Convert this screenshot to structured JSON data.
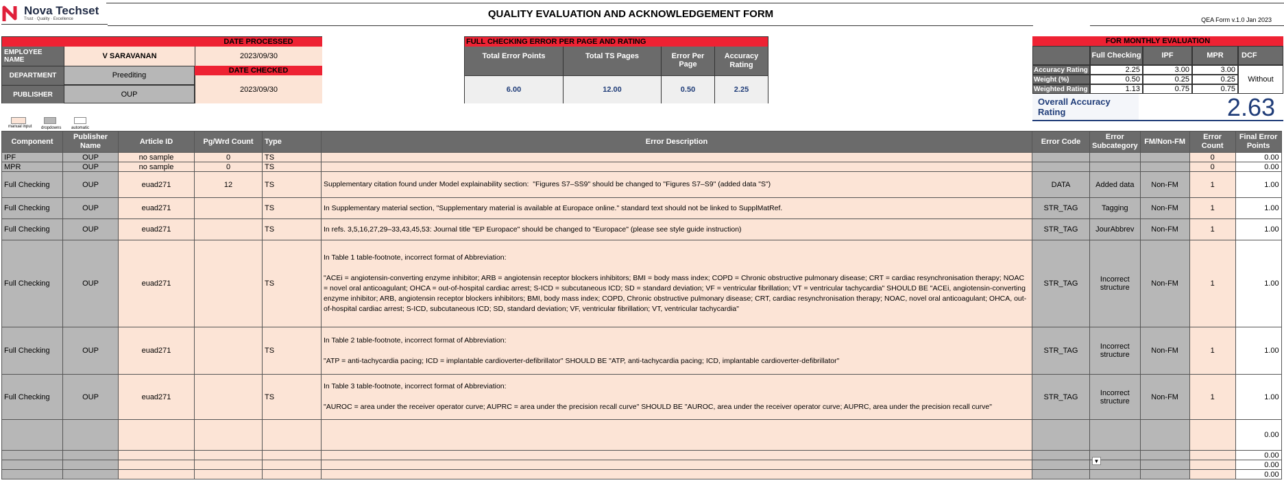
{
  "brand": {
    "name": "Nova Techset",
    "tagline": "Trust · Quality · Excellence"
  },
  "form_title": "QUALITY EVALUATION AND ACKNOWLEDGEMENT FORM",
  "form_version": "QEA Form v.1.0 Jan 2023",
  "employee": {
    "name_label": "EMPLOYEE NAME",
    "name": "V SARAVANAN",
    "dept_label": "DEPARTMENT",
    "dept": "Preediting",
    "pub_label": "PUBLISHER",
    "pub": "OUP",
    "date_processed_label": "DATE PROCESSED",
    "date_processed": "2023/09/30",
    "date_checked_label": "DATE CHECKED",
    "date_checked": "2023/09/30"
  },
  "full_check": {
    "header": "FULL CHECKING ERROR PER PAGE AND RATING",
    "cols": [
      "Total Error Points",
      "Total TS Pages",
      "Error Per Page",
      "Accuracy Rating"
    ],
    "vals": [
      "6.00",
      "12.00",
      "0.50",
      "2.25"
    ]
  },
  "monthly": {
    "header": "FOR MONTHLY EVALUATION",
    "cols": [
      "Full Checking",
      "IPF",
      "MPR",
      "DCF"
    ],
    "rows": [
      {
        "label": "Accuracy Rating",
        "vals": [
          "2.25",
          "3.00",
          "3.00"
        ]
      },
      {
        "label": "Weight (%)",
        "vals": [
          "0.50",
          "0.25",
          "0.25"
        ]
      },
      {
        "label": "Weighted Rating",
        "vals": [
          "1.13",
          "0.75",
          "0.75"
        ]
      }
    ],
    "dcf": "Without",
    "overall_label": "Overall Accuracy Rating",
    "overall_value": "2.63"
  },
  "legend": [
    "manual input",
    "dropdowns",
    "automatic"
  ],
  "table": {
    "headers": [
      "Component",
      "Publisher Name",
      "Article ID",
      "Pg/Wrd Count",
      "Type",
      "Error Description",
      "Error Code",
      "Error Subcategory",
      "FM/Non-FM",
      "Error Count",
      "Final Error Points"
    ],
    "rows": [
      {
        "comp": "IPF",
        "pub": "OUP",
        "art": "no sample",
        "pg": "0",
        "type": "TS",
        "desc": "",
        "code": "",
        "sub": "",
        "fm": "",
        "cnt": "0",
        "pts": "0.00"
      },
      {
        "comp": "MPR",
        "pub": "OUP",
        "art": "no sample",
        "pg": "0",
        "type": "TS",
        "desc": "",
        "code": "",
        "sub": "",
        "fm": "",
        "cnt": "0",
        "pts": "0.00"
      },
      {
        "comp": "Full Checking",
        "pub": "OUP",
        "art": "euad271",
        "pg": "12",
        "type": "TS",
        "desc": "Supplementary citation found under Model explainability section:  \"Figures S7–SS9\" should be changed to \"Figures S7–S9\" (added data \"S\")",
        "code": "DATA",
        "sub": "Added data",
        "fm": "Non-FM",
        "cnt": "1",
        "pts": "1.00"
      },
      {
        "comp": "Full Checking",
        "pub": "OUP",
        "art": "euad271",
        "pg": "",
        "type": "TS",
        "desc": "In Supplementary material section, \"Supplementary material is available at Europace online.\" standard text should not be linked to SupplMatRef.",
        "code": "STR_TAG",
        "sub": "Tagging",
        "fm": "Non-FM",
        "cnt": "1",
        "pts": "1.00"
      },
      {
        "comp": "Full Checking",
        "pub": "OUP",
        "art": "euad271",
        "pg": "",
        "type": "TS",
        "desc": "In refs. 3,5,16,27,29–33,43,45,53: Journal title \"EP Europace\" should be changed to \"Europace\" (please see style guide instruction)",
        "code": "STR_TAG",
        "sub": "JourAbbrev",
        "fm": "Non-FM",
        "cnt": "1",
        "pts": "1.00"
      },
      {
        "comp": "Full Checking",
        "pub": "OUP",
        "art": "euad271",
        "pg": "",
        "type": "TS",
        "desc": "In Table 1 table-footnote, incorrect format of Abbreviation:\n\n\"ACEi = angiotensin-converting enzyme inhibitor; ARB = angiotensin receptor blockers inhibitors; BMI = body mass index; COPD = Chronic obstructive pulmonary disease; CRT = cardiac resynchronisation therapy; NOAC = novel oral anticoagulant; OHCA = out-of-hospital cardiac arrest; S-ICD = subcutaneous ICD; SD = standard deviation; VF = ventricular fibrillation; VT = ventricular tachycardia\" SHOULD BE \"ACEi, angiotensin-converting enzyme inhibitor; ARB, angiotensin receptor blockers inhibitors; BMI, body mass index; COPD, Chronic obstructive pulmonary disease; CRT, cardiac resynchronisation therapy; NOAC, novel oral anticoagulant; OHCA, out-of-hospital cardiac arrest; S-ICD, subcutaneous ICD; SD, standard deviation; VF, ventricular fibrillation; VT, ventricular tachycardia\"",
        "code": "STR_TAG",
        "sub": "Incorrect structure",
        "fm": "Non-FM",
        "cnt": "1",
        "pts": "1.00"
      },
      {
        "comp": "Full Checking",
        "pub": "OUP",
        "art": "euad271",
        "pg": "",
        "type": "TS",
        "desc": "In Table 2 table-footnote, incorrect format of Abbreviation:\n\n\"ATP = anti-tachycardia pacing; ICD = implantable cardioverter-defibrillator\" SHOULD BE \"ATP, anti-tachycardia pacing; ICD, implantable cardioverter-defibrillator\"",
        "code": "STR_TAG",
        "sub": "Incorrect structure",
        "fm": "Non-FM",
        "cnt": "1",
        "pts": "1.00"
      },
      {
        "comp": "Full Checking",
        "pub": "OUP",
        "art": "euad271",
        "pg": "",
        "type": "TS",
        "desc": "In Table 3 table-footnote, incorrect format of Abbreviation:\n\n\"AUROC = area under the receiver operator curve; AUPRC = area under the precision recall curve\" SHOULD BE \"AUROC, area under the receiver operator curve; AUPRC, area under the precision recall curve\"",
        "code": "STR_TAG",
        "sub": "Incorrect structure",
        "fm": "Non-FM",
        "cnt": "1",
        "pts": "1.00"
      },
      {
        "comp": "",
        "pub": "",
        "art": "",
        "pg": "",
        "type": "",
        "desc": "",
        "code": "",
        "sub": "",
        "fm": "",
        "cnt": "",
        "pts": "0.00"
      },
      {
        "comp": "",
        "pub": "",
        "art": "",
        "pg": "",
        "type": "",
        "desc": "",
        "code": "",
        "sub": "",
        "fm": "",
        "cnt": "",
        "pts": "0.00"
      },
      {
        "comp": "",
        "pub": "",
        "art": "",
        "pg": "",
        "type": "",
        "desc": "",
        "code": "",
        "sub": "",
        "fm": "",
        "cnt": "",
        "pts": "0.00"
      },
      {
        "comp": "",
        "pub": "",
        "art": "",
        "pg": "",
        "type": "",
        "desc": "",
        "code": "",
        "sub": "",
        "fm": "",
        "cnt": "",
        "pts": "0.00"
      }
    ]
  }
}
